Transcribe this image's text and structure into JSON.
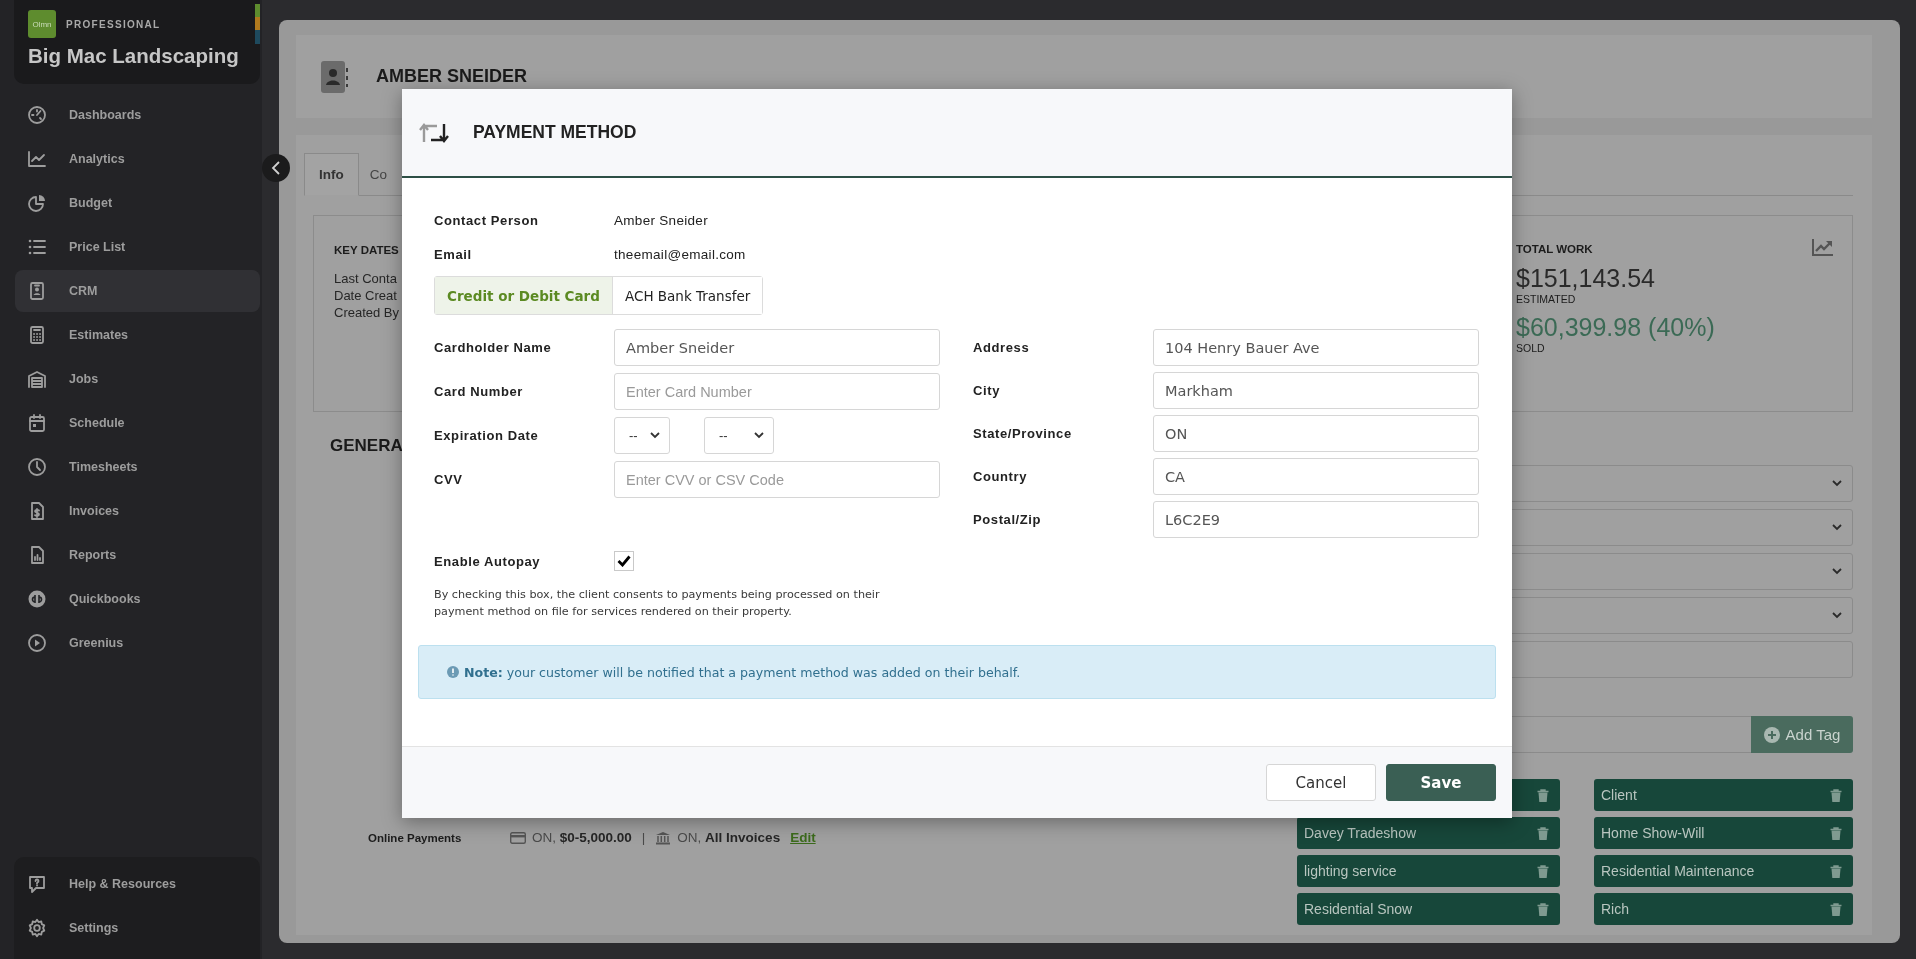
{
  "sidebar": {
    "logo_text": "Olmn",
    "plan": "PROFESSIONAL",
    "company": "Big Mac Landscaping",
    "items": [
      {
        "label": "Dashboards",
        "selected": false
      },
      {
        "label": "Analytics",
        "selected": false
      },
      {
        "label": "Budget",
        "selected": false
      },
      {
        "label": "Price List",
        "selected": false
      },
      {
        "label": "CRM",
        "selected": true
      },
      {
        "label": "Estimates",
        "selected": false
      },
      {
        "label": "Jobs",
        "selected": false
      },
      {
        "label": "Schedule",
        "selected": false
      },
      {
        "label": "Timesheets",
        "selected": false
      },
      {
        "label": "Invoices",
        "selected": false
      },
      {
        "label": "Reports",
        "selected": false
      },
      {
        "label": "Quickbooks",
        "selected": false
      },
      {
        "label": "Greenius",
        "selected": false
      }
    ],
    "footer_items": [
      {
        "label": "Help & Resources"
      },
      {
        "label": "Settings"
      }
    ]
  },
  "contact": {
    "name": "AMBER SNEIDER"
  },
  "tabs": [
    {
      "label": "Info",
      "selected": true
    },
    {
      "label": "Co",
      "selected": false
    }
  ],
  "key_dates": {
    "title": "KEY DATES",
    "rows": [
      "Last Conta",
      "Date Creat",
      "Created By"
    ]
  },
  "general_heading": "GENERA",
  "online_payments": {
    "label": "Online Payments",
    "card": "ON, **$0-5,000.00**",
    "separator": "|",
    "bank": "ON, **All Invoices**",
    "edit_link": "Edit"
  },
  "total_work": {
    "title": "TOTAL WORK",
    "estimated": "$151,143.54",
    "estimated_label": "ESTIMATED",
    "sold": "$60,399.98 (40%)",
    "sold_label": "SOLD"
  },
  "fields": [
    {
      "kind": "select"
    },
    {
      "kind": "select"
    },
    {
      "kind": "select"
    },
    {
      "kind": "select"
    },
    {
      "kind": "input"
    }
  ],
  "add_tag_button": "Add Tag",
  "tags": [
    {
      "kind": "tag"
    },
    {
      "kind": "tag",
      "label": "Client"
    },
    {
      "kind": "tag",
      "label": "Davey Tradeshow"
    },
    {
      "kind": "tag",
      "label": "Home Show-Will"
    },
    {
      "kind": "tag",
      "label": "lighting service"
    },
    {
      "kind": "tag",
      "label": "Residential Maintenance"
    },
    {
      "kind": "tag",
      "label": "Residential Snow"
    },
    {
      "kind": "tag",
      "label": "Rich"
    }
  ],
  "modal": {
    "title": "PAYMENT METHOD",
    "contact_person": {
      "label": "Contact Person",
      "value": "Amber Sneider"
    },
    "email": {
      "label": "Email",
      "value": "theemail@email.com"
    },
    "methods": [
      {
        "label": "Credit or Debit Card",
        "selected": true
      },
      {
        "label": "ACH Bank Transfer",
        "selected": false
      }
    ],
    "card_fields": [
      {
        "kind": "text",
        "label": "Cardholder Name",
        "value": "Amber Sneider"
      },
      {
        "kind": "text",
        "label": "Card Number",
        "placeholder": "Enter Card Number"
      },
      {
        "kind": "date",
        "label": "Expiration Date",
        "selects": [
          "--",
          "--"
        ]
      },
      {
        "kind": "text",
        "label": "CVV",
        "placeholder": "Enter CVV or CSV Code"
      }
    ],
    "address_fields": [
      {
        "label": "Address",
        "value": "104 Henry Bauer Ave"
      },
      {
        "label": "City",
        "value": "Markham"
      },
      {
        "label": "State/Province",
        "value": "ON"
      },
      {
        "label": "Country",
        "value": "CA"
      },
      {
        "label": "Postal/Zip",
        "value": "L6C2E9"
      }
    ],
    "autopay": {
      "label": "Enable Autopay",
      "checked": true,
      "consent": "By checking this box, the client consents to payments being processed on their payment method on file for services rendered on their property."
    },
    "note": "**Note:** your customer will be notified that a payment method was added on their behalf.",
    "buttons": [
      {
        "label": "Cancel",
        "kind": "secondary"
      },
      {
        "label": "Save",
        "kind": "primary"
      }
    ]
  }
}
